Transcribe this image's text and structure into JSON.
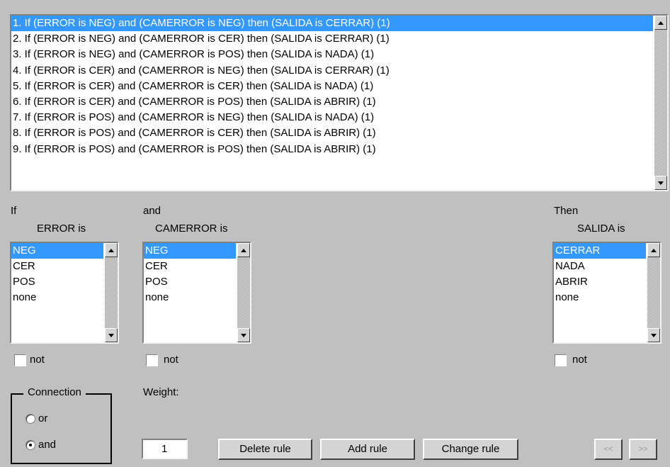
{
  "rules": [
    "1. If (ERROR is NEG) and (CAMERROR is NEG) then (SALIDA is CERRAR) (1)",
    "2. If (ERROR is NEG) and (CAMERROR is CER) then (SALIDA is CERRAR) (1)",
    "3. If (ERROR is NEG) and (CAMERROR is POS) then (SALIDA is NADA) (1)",
    "4. If (ERROR is CER) and (CAMERROR is NEG) then (SALIDA is CERRAR) (1)",
    "5. If (ERROR is CER) and (CAMERROR is CER) then (SALIDA is NADA) (1)",
    "6. If (ERROR is CER) and (CAMERROR is POS) then (SALIDA is ABRIR) (1)",
    "7. If (ERROR is POS) and (CAMERROR is NEG) then (SALIDA is NADA) (1)",
    "8. If (ERROR is POS) and (CAMERROR is CER) then (SALIDA is ABRIR) (1)",
    "9. If (ERROR is POS) and (CAMERROR is POS) then (SALIDA is ABRIR) (1)"
  ],
  "selected_rule": 0,
  "if_section": {
    "prefix": "If",
    "var_label": "ERROR is",
    "options": [
      "NEG",
      "CER",
      "POS",
      "none"
    ],
    "selected": 0,
    "not_label": "not",
    "not_checked": false
  },
  "and_section": {
    "prefix": "and",
    "var_label": "CAMERROR is",
    "options": [
      "NEG",
      "CER",
      "POS",
      "none"
    ],
    "selected": 0,
    "not_label": "not",
    "not_checked": false
  },
  "then_section": {
    "prefix": "Then",
    "var_label": "SALIDA is",
    "options": [
      "CERRAR",
      "NADA",
      "ABRIR",
      "none"
    ],
    "selected": 0,
    "not_label": "not",
    "not_checked": false
  },
  "connection": {
    "title": "Connection",
    "options": [
      "or",
      "and"
    ],
    "selected": "and"
  },
  "weight": {
    "label": "Weight:",
    "value": "1"
  },
  "buttons": {
    "delete": "Delete rule",
    "add": "Add rule",
    "change": "Change rule",
    "prev": "<<",
    "next": ">>"
  },
  "colors": {
    "background": "#c0c0c0",
    "selection": "#3399ff"
  }
}
